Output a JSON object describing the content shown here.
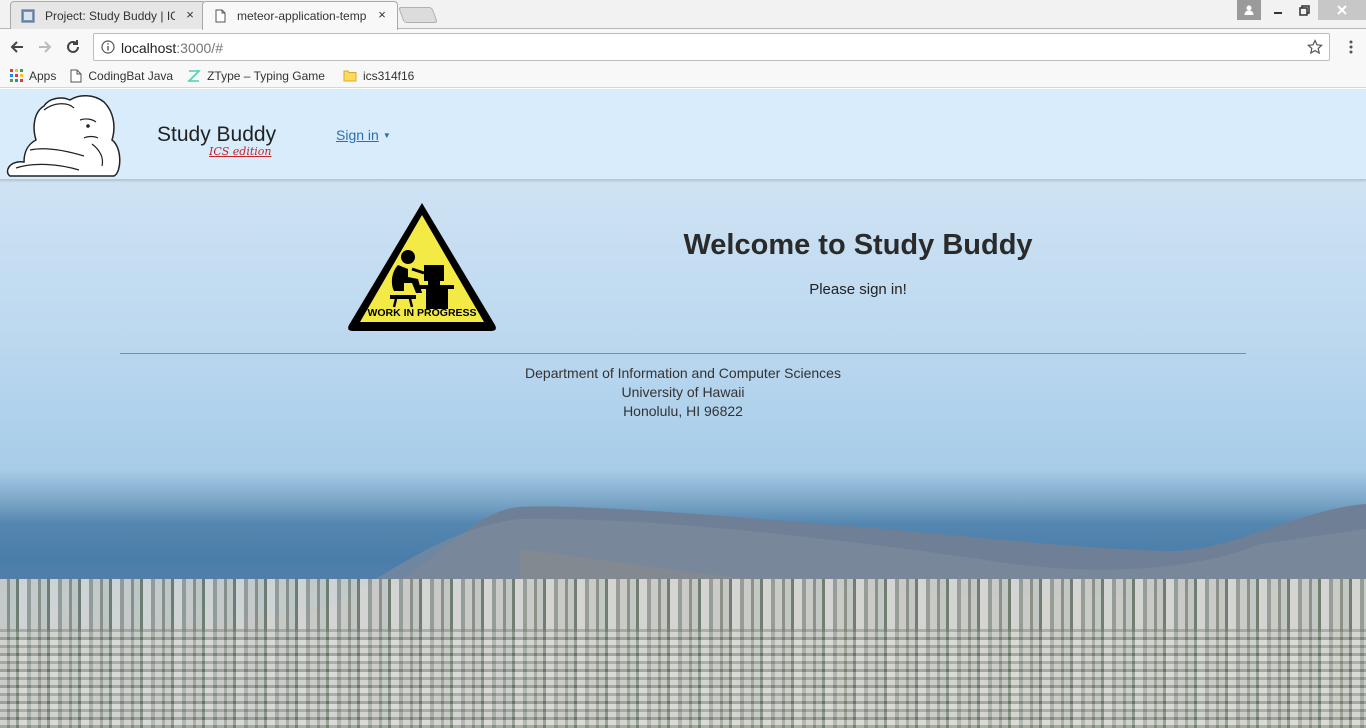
{
  "browser": {
    "tabs": [
      {
        "title": "Project: Study Buddy | IC",
        "close": "×"
      },
      {
        "title": "meteor-application-temp",
        "close": "×"
      }
    ],
    "address": {
      "host": "localhost",
      "rest": ":3000/#"
    },
    "bookmarks": [
      {
        "label": "Apps"
      },
      {
        "label": "CodingBat Java"
      },
      {
        "label": "ZType – Typing Game"
      },
      {
        "label": "ics314f16"
      }
    ]
  },
  "header": {
    "brand": "Study Buddy",
    "brand_sub": "ICS edition",
    "signin": "Sign in",
    "signin_caret": "▼"
  },
  "main": {
    "sign_text": "WORK IN PROGRESS",
    "welcome": "Welcome to Study Buddy",
    "please": "Please sign in!"
  },
  "footer": {
    "line1": "Department of Information and Computer Sciences",
    "line2": "University of Hawaii",
    "line3": "Honolulu, HI 96822"
  },
  "icons": {
    "tab1": "page-icon",
    "tab2": "document-icon",
    "back": "arrow-left-icon",
    "forward": "arrow-right-icon",
    "reload": "reload-icon",
    "info": "info-icon",
    "star": "star-icon",
    "menu": "kebab-menu-icon"
  }
}
